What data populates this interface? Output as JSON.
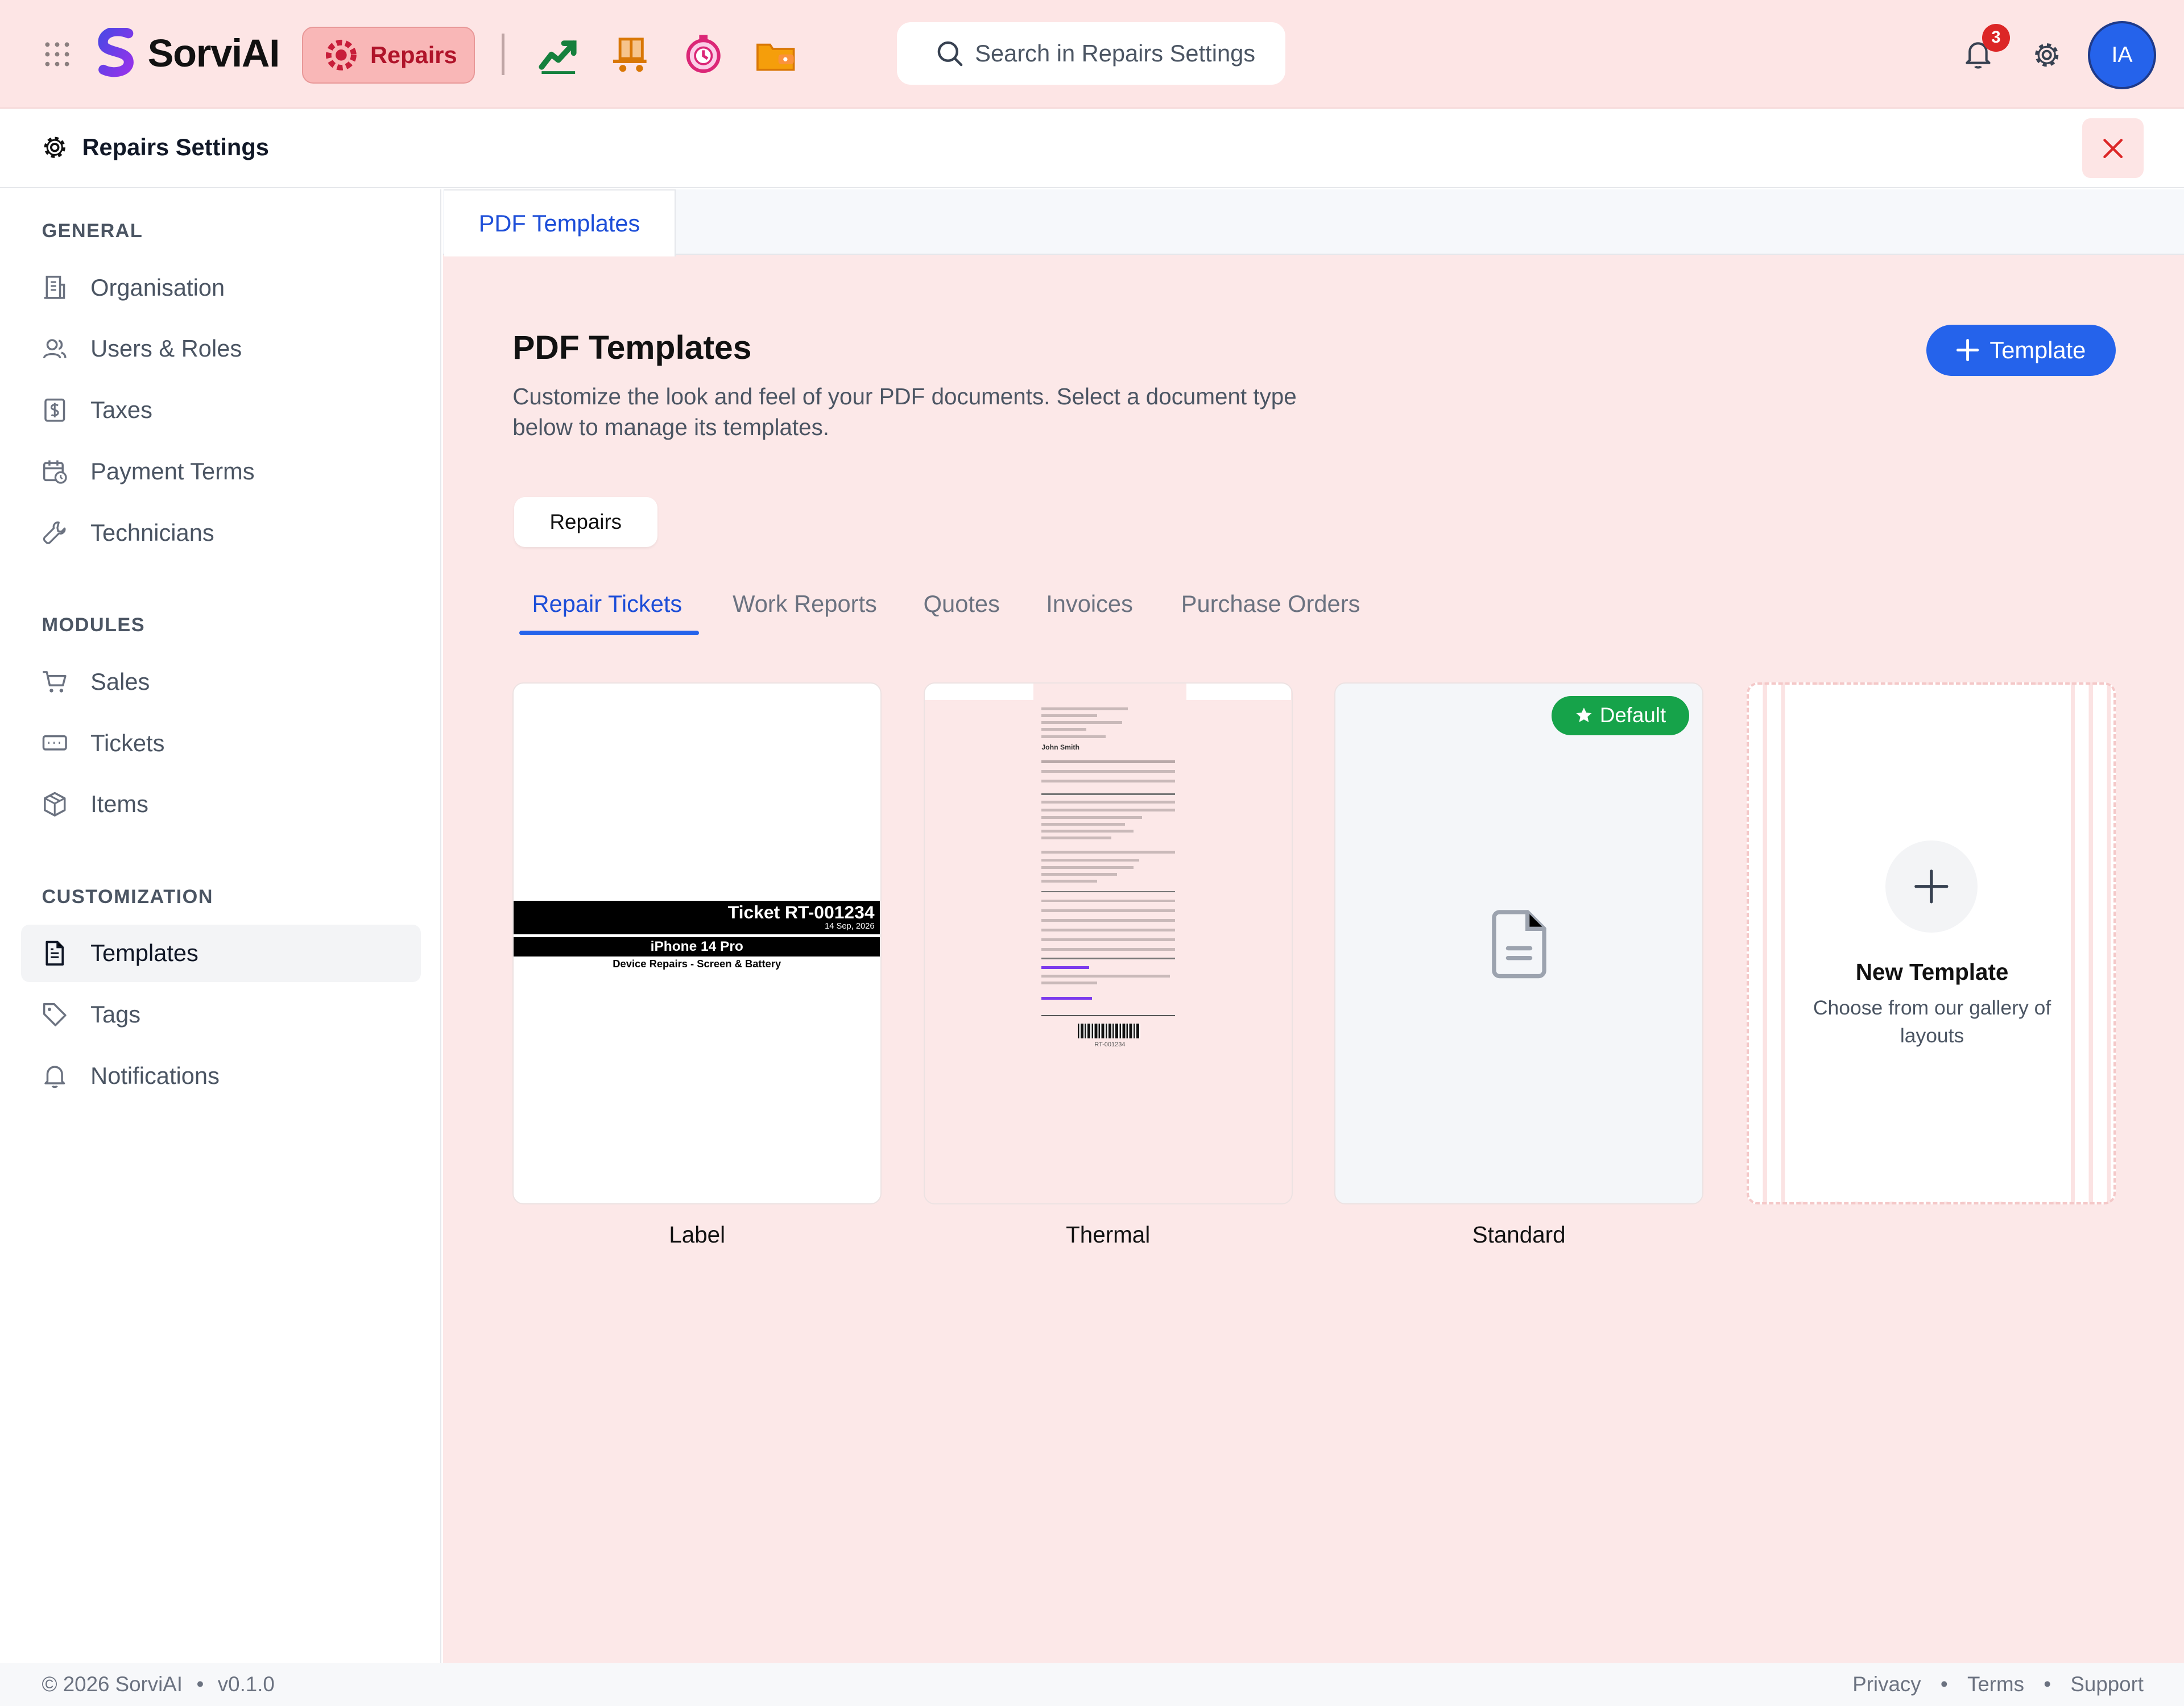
{
  "app": {
    "name": "SorviAI",
    "module": "Repairs"
  },
  "header": {
    "search_placeholder": "Search in Repairs Settings",
    "notifications_count": "3",
    "avatar_initials": "IA"
  },
  "settings": {
    "title": "Repairs Settings"
  },
  "sidebar": {
    "general_heading": "GENERAL",
    "general": [
      "Organisation",
      "Users & Roles",
      "Taxes",
      "Payment Terms",
      "Technicians"
    ],
    "modules_heading": "MODULES",
    "modules": [
      "Sales",
      "Tickets",
      "Items"
    ],
    "customization_heading": "CUSTOMIZATION",
    "customization": [
      "Templates",
      "Tags",
      "Notifications"
    ],
    "active": "Templates"
  },
  "content": {
    "tab": "PDF Templates",
    "title": "PDF Templates",
    "description": "Customize the look and feel of your PDF documents. Select a document type below to manage its templates.",
    "add_button": "Template",
    "group": "Repairs",
    "doc_tabs": [
      "Repair Tickets",
      "Work Reports",
      "Quotes",
      "Invoices",
      "Purchase Orders"
    ],
    "active_doc_tab": "Repair Tickets",
    "cards": [
      {
        "name": "Label",
        "preview": {
          "ticket": "Ticket RT-001234",
          "date": "14 Sep, 2026",
          "device": "iPhone 14 Pro",
          "service": "Device Repairs - Screen & Battery"
        }
      },
      {
        "name": "Thermal",
        "preview": {
          "title": "Ticket # RT-001234",
          "customer": "John Smith",
          "barcode_text": "RT-001234"
        }
      },
      {
        "name": "Standard",
        "badge": "Default"
      }
    ],
    "new_card": {
      "title": "New Template",
      "subtitle": "Choose from our gallery of layouts"
    }
  },
  "footer": {
    "copyright": "© 2026 SorviAI",
    "version": "v0.1.0",
    "links": [
      "Privacy",
      "Terms",
      "Support"
    ]
  },
  "colors": {
    "accent": "#2563eb",
    "topbar": "#fde5e5",
    "content_bg": "#fce8e8",
    "default_badge": "#16a34a",
    "module_pill": "#f9b7b7"
  }
}
